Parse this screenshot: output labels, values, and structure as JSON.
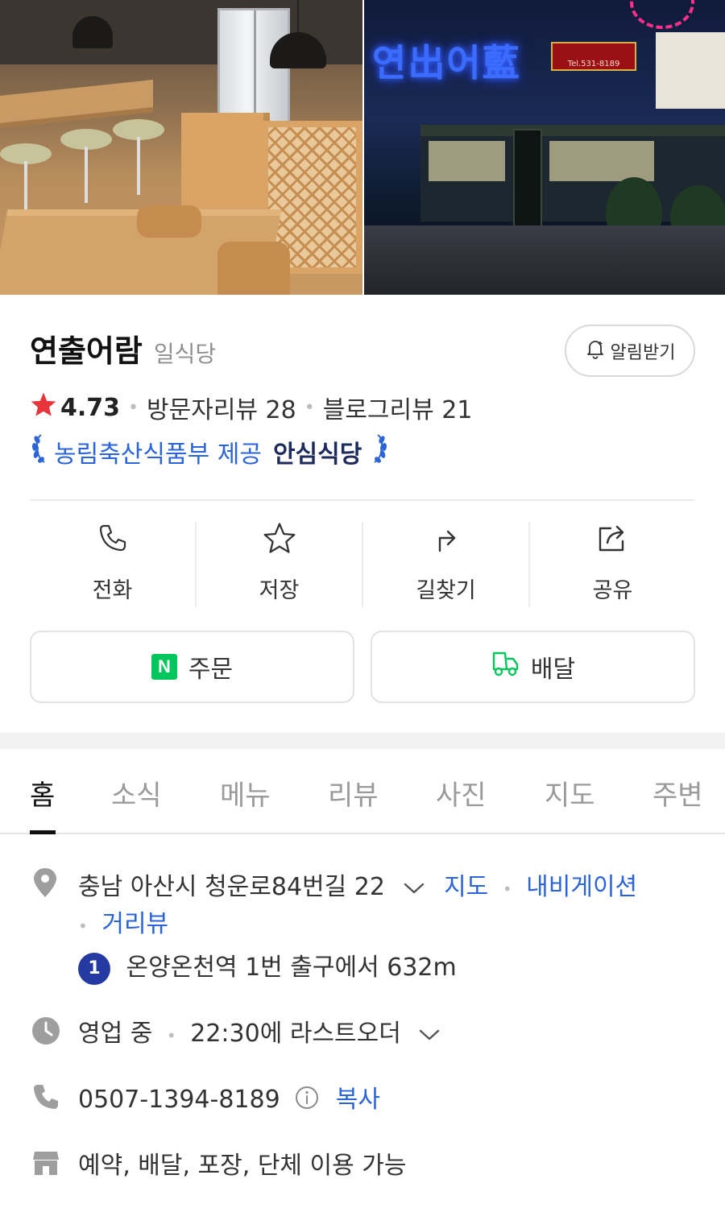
{
  "place": {
    "name": "연출어람",
    "category": "일식당",
    "alarm_label": "알림받기",
    "rating": "4.73",
    "visitor_reviews": "방문자리뷰 28",
    "blog_reviews": "블로그리뷰 21",
    "badge_prefix": "농림축산식품부 제공",
    "badge_title": "안심식당"
  },
  "photos": {
    "sign_text": "연出어藍",
    "plaque_text": "Tel.531-8189"
  },
  "actions": [
    {
      "label": "전화",
      "icon": "phone-icon"
    },
    {
      "label": "저장",
      "icon": "star-icon"
    },
    {
      "label": "길찾기",
      "icon": "directions-icon"
    },
    {
      "label": "공유",
      "icon": "share-icon"
    }
  ],
  "order": {
    "order_label": "주문",
    "n_logo": "N",
    "delivery_label": "배달"
  },
  "tabs": [
    "홈",
    "소식",
    "메뉴",
    "리뷰",
    "사진",
    "지도",
    "주변"
  ],
  "info": {
    "address": "충남 아산시 청운로84번길 22",
    "map_link": "지도",
    "navi_link": "내비게이션",
    "street_link": "거리뷰",
    "station_number": "1",
    "station_text": "온양온천역 1번 출구에서 632m",
    "status": "영업 중",
    "last_order": "22:30에 라스트오더",
    "phone": "0507-1394-8189",
    "copy_label": "복사",
    "services": "예약, 배달, 포장, 단체 이용 가능"
  },
  "colors": {
    "accent_blue": "#2b63d9",
    "rating_star": "#e8343b",
    "naver_green": "#03c75a"
  }
}
